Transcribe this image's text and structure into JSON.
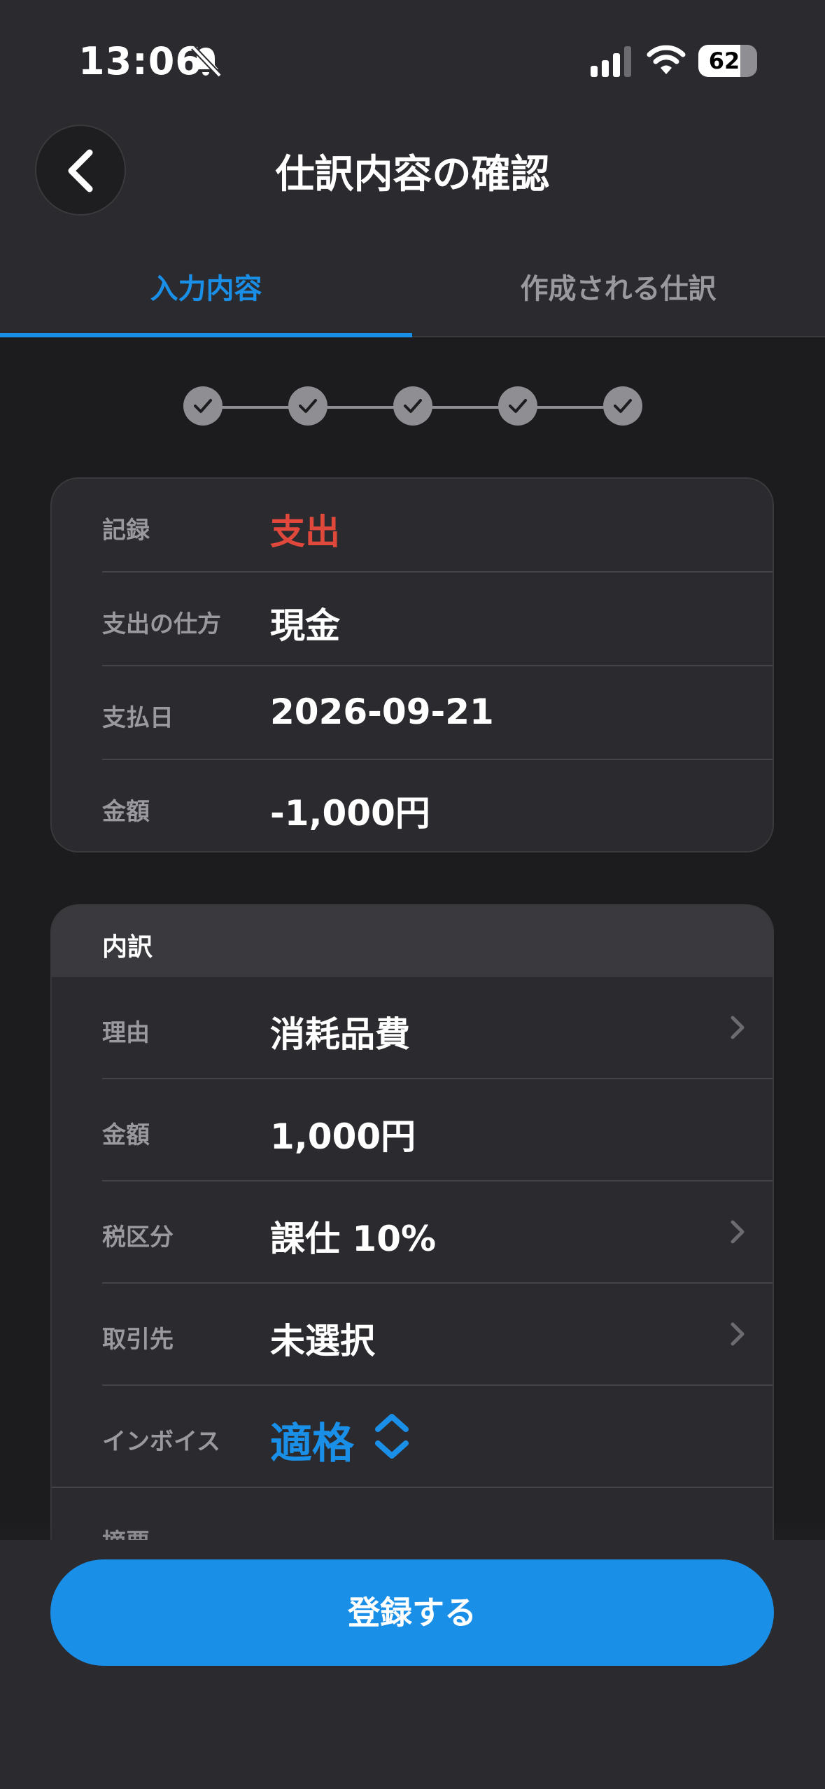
{
  "status_bar": {
    "time": "13:06",
    "battery": "62"
  },
  "header": {
    "title": "仕訳内容の確認"
  },
  "tabs": [
    {
      "label": "入力内容"
    },
    {
      "label": "作成される仕訳"
    }
  ],
  "summary": {
    "record_label": "記録",
    "record_value": "支出",
    "method_label": "支出の仕方",
    "method_value": "現金",
    "date_label": "支払日",
    "date_value": "2026-09-21",
    "amount_label": "金額",
    "amount_value": "-1,000円"
  },
  "breakdown": {
    "title": "内訳",
    "reason_label": "理由",
    "reason_value": "消耗品費",
    "amount_label": "金額",
    "amount_value": "1,000円",
    "tax_label": "税区分",
    "tax_value": "課仕 10%",
    "partner_label": "取引先",
    "partner_value": "未選択",
    "invoice_label": "インボイス",
    "invoice_value": "適格",
    "memo_label": "摘要"
  },
  "footer": {
    "register_label": "登録する"
  },
  "colors": {
    "accent": "#1a8fe8",
    "expense": "#e0483c",
    "background": "#1c1c1e",
    "card": "#2b2b2f"
  },
  "icons": [
    "bell-slash-icon",
    "signal-icon",
    "wifi-icon",
    "battery-icon",
    "chevron-left-icon",
    "check-icon",
    "chevron-right-icon",
    "chevron-up-down-icon"
  ]
}
